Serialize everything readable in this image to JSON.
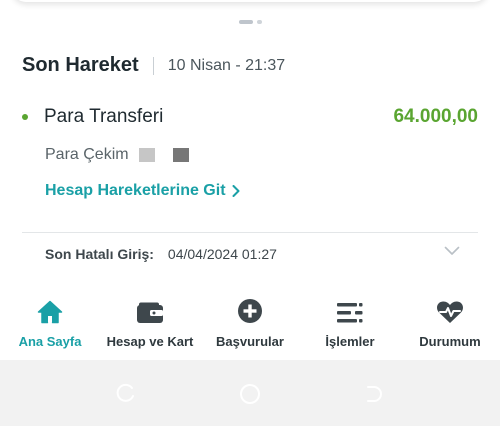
{
  "recent_activity": {
    "title": "Son Hareket",
    "date": "10 Nisan - 21:37",
    "transaction": {
      "title": "Para Transferi",
      "amount": "64.000,00",
      "subtitle": "Para Çekim"
    },
    "link_label": "Hesap Hareketlerine Git"
  },
  "last_failed_login": {
    "label": "Son Hatalı Giriş:",
    "value": "04/04/2024 01:27"
  },
  "bottom_nav": {
    "items": [
      {
        "label": "Ana Sayfa",
        "icon": "home-icon",
        "active": true
      },
      {
        "label": "Hesap ve Kart",
        "icon": "wallet-icon",
        "active": false
      },
      {
        "label": "Başvurular",
        "icon": "plus-circle-icon",
        "active": false
      },
      {
        "label": "İşlemler",
        "icon": "list-icon",
        "active": false
      },
      {
        "label": "Durumum",
        "icon": "heart-pulse-icon",
        "active": false
      }
    ]
  },
  "colors": {
    "accent": "#1aa0a6",
    "positive_amount": "#5aa531",
    "text_dark": "#1f2a30"
  }
}
